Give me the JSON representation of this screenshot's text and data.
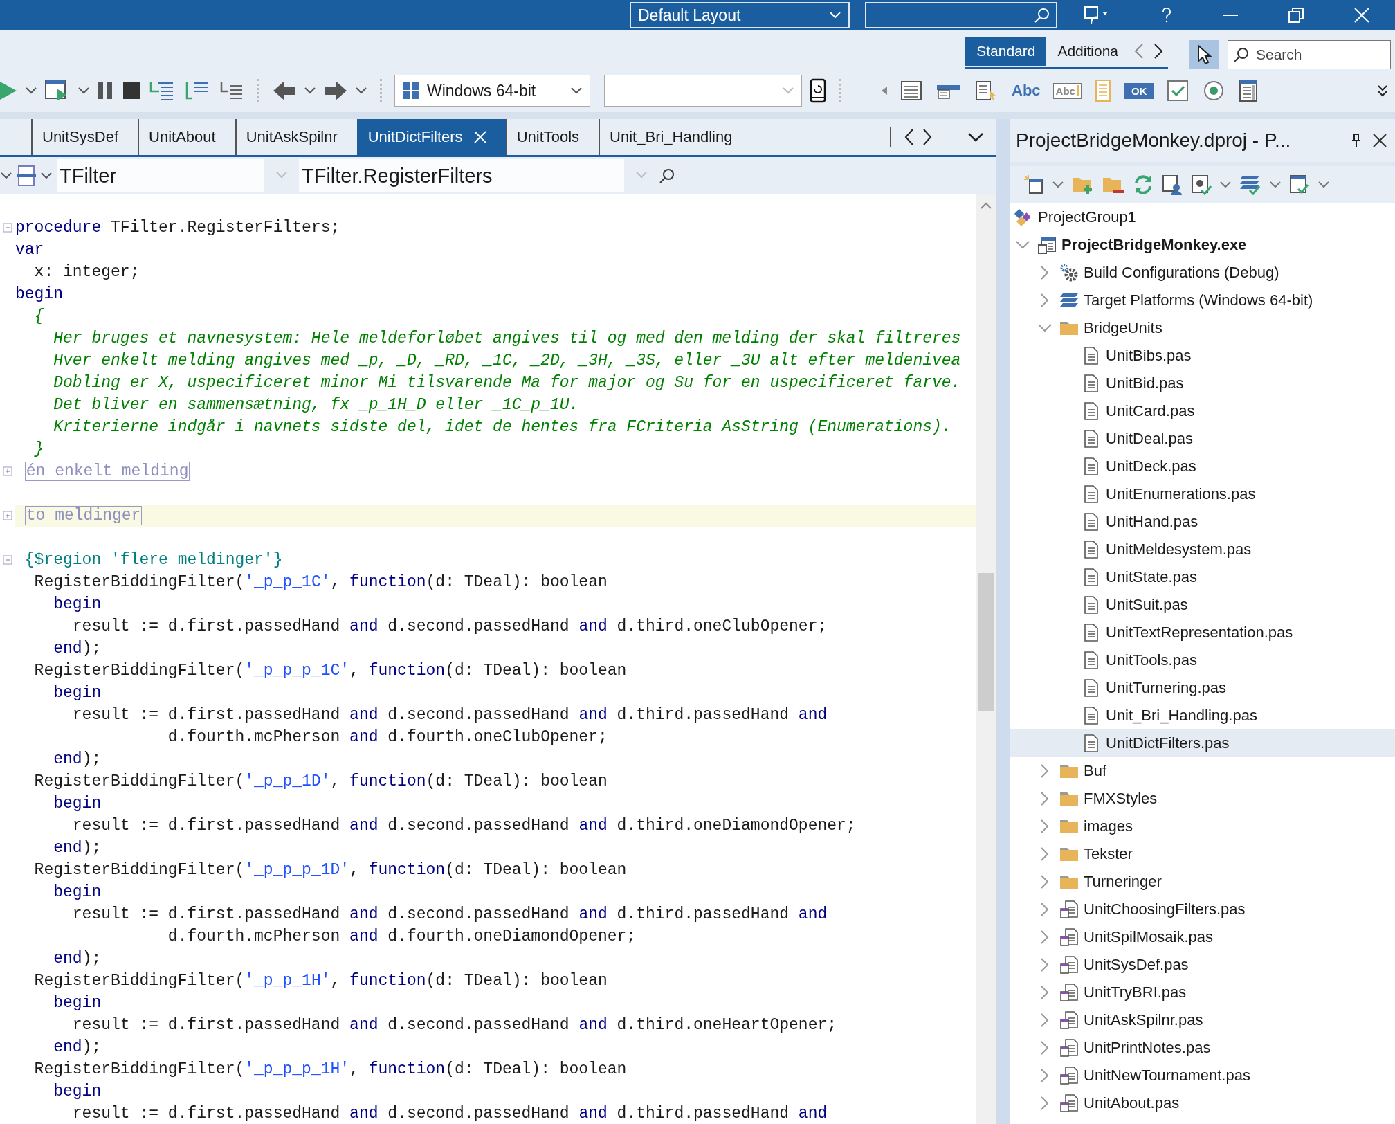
{
  "title_bar": {
    "layout": "Default Layout"
  },
  "palette": {
    "tabs": [
      {
        "label": "Standard",
        "selected": true
      },
      {
        "label": "Additiona",
        "selected": false
      }
    ],
    "search": {
      "placeholder": "Search"
    },
    "items": [
      {
        "kind": "frame"
      },
      {
        "kind": "menu"
      },
      {
        "kind": "popup"
      },
      {
        "kind": "label",
        "text": "Abc"
      },
      {
        "kind": "edit",
        "text": "Abc"
      },
      {
        "kind": "memo"
      },
      {
        "kind": "button",
        "text": "OK"
      },
      {
        "kind": "checkbox"
      },
      {
        "kind": "radio"
      },
      {
        "kind": "listbox"
      }
    ]
  },
  "toolbar": {
    "platform": "Windows 64-bit"
  },
  "editor": {
    "tabs": [
      {
        "label": "UnitSysDef",
        "selected": false
      },
      {
        "label": "UnitAbout",
        "selected": false
      },
      {
        "label": "UnitAskSpilnr",
        "selected": false
      },
      {
        "label": "UnitDictFilters",
        "selected": true
      },
      {
        "label": "UnitTools",
        "selected": false
      },
      {
        "label": "Unit_Bri_Handling",
        "selected": false
      }
    ],
    "nav": {
      "class": "TFilter",
      "method": "TFilter.RegisterFilters"
    },
    "lines": [
      {
        "current": false
      },
      {
        "current": false,
        "folded": false,
        "tokens": [
          {
            "kind": "keyword",
            "text": "procedure"
          },
          {
            "kind": "plain",
            "text": " TFilter.RegisterFilters;"
          }
        ]
      },
      {
        "current": false,
        "tokens": [
          {
            "kind": "keyword",
            "text": "var"
          }
        ]
      },
      {
        "current": false,
        "tokens": [
          {
            "kind": "plain",
            "text": "  x: integer;"
          }
        ]
      },
      {
        "current": false,
        "tokens": [
          {
            "kind": "keyword",
            "text": "begin"
          }
        ]
      },
      {
        "current": false,
        "tokens": [
          {
            "kind": "comment",
            "text": "  {"
          }
        ]
      },
      {
        "current": false,
        "tokens": [
          {
            "kind": "comment",
            "text": "    Her bruges et navnesystem: Hele meldeforløbet angives til og med den melding der skal filtreres"
          }
        ]
      },
      {
        "current": false,
        "tokens": [
          {
            "kind": "comment",
            "text": "    Hver enkelt melding angives med _p, _D, _RD, _1C, _2D, _3H, _3S, eller _3U alt efter meldenivea"
          }
        ]
      },
      {
        "current": false,
        "tokens": [
          {
            "kind": "comment",
            "text": "    Dobling er X, uspecificeret minor Mi tilsvarende Ma for major og Su for en uspecificeret farve."
          }
        ]
      },
      {
        "current": false,
        "tokens": [
          {
            "kind": "comment",
            "text": "    Det bliver en sammensætning, fx _p_1H_D eller _1C_p_1U."
          }
        ]
      },
      {
        "current": false,
        "tokens": [
          {
            "kind": "comment",
            "text": "    Kriterierne indgår i navnets sidste del, idet de hentes fra FCriteria AsString (Enumerations)."
          }
        ]
      },
      {
        "current": false,
        "tokens": [
          {
            "kind": "comment",
            "text": "  }"
          }
        ]
      },
      {
        "current": false,
        "folded": true,
        "region": "én enkelt melding"
      },
      {
        "current": false
      },
      {
        "current": true,
        "folded": true,
        "region": "to meldinger"
      },
      {
        "current": false
      },
      {
        "current": false,
        "folded": false,
        "tokens": [
          {
            "kind": "directive",
            "text": " {$region 'flere meldinger'}"
          }
        ]
      },
      {
        "current": false,
        "tokens": [
          {
            "kind": "plain",
            "text": "  RegisterBiddingFilter("
          },
          {
            "kind": "string",
            "text": "'_p_p_1C'"
          },
          {
            "kind": "plain",
            "text": ", "
          },
          {
            "kind": "keyword",
            "text": "function"
          },
          {
            "kind": "plain",
            "text": "(d: TDeal): boolean"
          }
        ]
      },
      {
        "current": false,
        "tokens": [
          {
            "kind": "keyword",
            "text": "    begin"
          }
        ]
      },
      {
        "current": false,
        "tokens": [
          {
            "kind": "plain",
            "text": "      result := d.first.passedHand "
          },
          {
            "kind": "keyword",
            "text": "and"
          },
          {
            "kind": "plain",
            "text": " d.second.passedHand "
          },
          {
            "kind": "keyword",
            "text": "and"
          },
          {
            "kind": "plain",
            "text": " d.third.oneClubOpener;"
          }
        ]
      },
      {
        "current": false,
        "tokens": [
          {
            "kind": "keyword",
            "text": "    end"
          },
          {
            "kind": "plain",
            "text": ");"
          }
        ]
      },
      {
        "current": false,
        "tokens": [
          {
            "kind": "plain",
            "text": "  RegisterBiddingFilter("
          },
          {
            "kind": "string",
            "text": "'_p_p_p_1C'"
          },
          {
            "kind": "plain",
            "text": ", "
          },
          {
            "kind": "keyword",
            "text": "function"
          },
          {
            "kind": "plain",
            "text": "(d: TDeal): boolean"
          }
        ]
      },
      {
        "current": false,
        "tokens": [
          {
            "kind": "keyword",
            "text": "    begin"
          }
        ]
      },
      {
        "current": false,
        "tokens": [
          {
            "kind": "plain",
            "text": "      result := d.first.passedHand "
          },
          {
            "kind": "keyword",
            "text": "and"
          },
          {
            "kind": "plain",
            "text": " d.second.passedHand "
          },
          {
            "kind": "keyword",
            "text": "and"
          },
          {
            "kind": "plain",
            "text": " d.third.passedHand "
          },
          {
            "kind": "keyword",
            "text": "and"
          }
        ]
      },
      {
        "current": false,
        "tokens": [
          {
            "kind": "plain",
            "text": "                d.fourth.mcPherson "
          },
          {
            "kind": "keyword",
            "text": "and"
          },
          {
            "kind": "plain",
            "text": " d.fourth.oneClubOpener;"
          }
        ]
      },
      {
        "current": false,
        "tokens": [
          {
            "kind": "keyword",
            "text": "    end"
          },
          {
            "kind": "plain",
            "text": ");"
          }
        ]
      },
      {
        "current": false,
        "tokens": [
          {
            "kind": "plain",
            "text": "  RegisterBiddingFilter("
          },
          {
            "kind": "string",
            "text": "'_p_p_1D'"
          },
          {
            "kind": "plain",
            "text": ", "
          },
          {
            "kind": "keyword",
            "text": "function"
          },
          {
            "kind": "plain",
            "text": "(d: TDeal): boolean"
          }
        ]
      },
      {
        "current": false,
        "tokens": [
          {
            "kind": "keyword",
            "text": "    begin"
          }
        ]
      },
      {
        "current": false,
        "tokens": [
          {
            "kind": "plain",
            "text": "      result := d.first.passedHand "
          },
          {
            "kind": "keyword",
            "text": "and"
          },
          {
            "kind": "plain",
            "text": " d.second.passedHand "
          },
          {
            "kind": "keyword",
            "text": "and"
          },
          {
            "kind": "plain",
            "text": " d.third.oneDiamondOpener;"
          }
        ]
      },
      {
        "current": false,
        "tokens": [
          {
            "kind": "keyword",
            "text": "    end"
          },
          {
            "kind": "plain",
            "text": ");"
          }
        ]
      },
      {
        "current": false,
        "tokens": [
          {
            "kind": "plain",
            "text": "  RegisterBiddingFilter("
          },
          {
            "kind": "string",
            "text": "'_p_p_p_1D'"
          },
          {
            "kind": "plain",
            "text": ", "
          },
          {
            "kind": "keyword",
            "text": "function"
          },
          {
            "kind": "plain",
            "text": "(d: TDeal): boolean"
          }
        ]
      },
      {
        "current": false,
        "tokens": [
          {
            "kind": "keyword",
            "text": "    begin"
          }
        ]
      },
      {
        "current": false,
        "tokens": [
          {
            "kind": "plain",
            "text": "      result := d.first.passedHand "
          },
          {
            "kind": "keyword",
            "text": "and"
          },
          {
            "kind": "plain",
            "text": " d.second.passedHand "
          },
          {
            "kind": "keyword",
            "text": "and"
          },
          {
            "kind": "plain",
            "text": " d.third.passedHand "
          },
          {
            "kind": "keyword",
            "text": "and"
          }
        ]
      },
      {
        "current": false,
        "tokens": [
          {
            "kind": "plain",
            "text": "                d.fourth.mcPherson "
          },
          {
            "kind": "keyword",
            "text": "and"
          },
          {
            "kind": "plain",
            "text": " d.fourth.oneDiamondOpener;"
          }
        ]
      },
      {
        "current": false,
        "tokens": [
          {
            "kind": "keyword",
            "text": "    end"
          },
          {
            "kind": "plain",
            "text": ");"
          }
        ]
      },
      {
        "current": false,
        "tokens": [
          {
            "kind": "plain",
            "text": "  RegisterBiddingFilter("
          },
          {
            "kind": "string",
            "text": "'_p_p_1H'"
          },
          {
            "kind": "plain",
            "text": ", "
          },
          {
            "kind": "keyword",
            "text": "function"
          },
          {
            "kind": "plain",
            "text": "(d: TDeal): boolean"
          }
        ]
      },
      {
        "current": false,
        "tokens": [
          {
            "kind": "keyword",
            "text": "    begin"
          }
        ]
      },
      {
        "current": false,
        "tokens": [
          {
            "kind": "plain",
            "text": "      result := d.first.passedHand "
          },
          {
            "kind": "keyword",
            "text": "and"
          },
          {
            "kind": "plain",
            "text": " d.second.passedHand "
          },
          {
            "kind": "keyword",
            "text": "and"
          },
          {
            "kind": "plain",
            "text": " d.third.oneHeartOpener;"
          }
        ]
      },
      {
        "current": false,
        "tokens": [
          {
            "kind": "keyword",
            "text": "    end"
          },
          {
            "kind": "plain",
            "text": ");"
          }
        ]
      },
      {
        "current": false,
        "tokens": [
          {
            "kind": "plain",
            "text": "  RegisterBiddingFilter("
          },
          {
            "kind": "string",
            "text": "'_p_p_p_1H'"
          },
          {
            "kind": "plain",
            "text": ", "
          },
          {
            "kind": "keyword",
            "text": "function"
          },
          {
            "kind": "plain",
            "text": "(d: TDeal): boolean"
          }
        ]
      },
      {
        "current": false,
        "tokens": [
          {
            "kind": "keyword",
            "text": "    begin"
          }
        ]
      },
      {
        "current": false,
        "tokens": [
          {
            "kind": "plain",
            "text": "      result := d.first.passedHand "
          },
          {
            "kind": "keyword",
            "text": "and"
          },
          {
            "kind": "plain",
            "text": " d.second.passedHand "
          },
          {
            "kind": "keyword",
            "text": "and"
          },
          {
            "kind": "plain",
            "text": " d.third.passedHand "
          },
          {
            "kind": "keyword",
            "text": "and"
          }
        ]
      }
    ]
  },
  "project_manager": {
    "title": "ProjectBridgeMonkey.dproj - P...",
    "tree": [
      {
        "label": "ProjectGroup1",
        "kind": "group",
        "selected": false,
        "children": [
          {
            "label": "ProjectBridgeMonkey.exe",
            "kind": "project",
            "selected": false,
            "expanded": true,
            "children": [
              {
                "label": "Build Configurations (Debug)",
                "kind": "config",
                "selected": false,
                "expanded": false
              },
              {
                "label": "Target Platforms (Windows 64-bit)",
                "kind": "platform",
                "selected": false,
                "expanded": false
              },
              {
                "label": "BridgeUnits",
                "kind": "folder",
                "selected": false,
                "expanded": true,
                "children": [
                  {
                    "label": "UnitBibs.pas",
                    "kind": "file",
                    "selected": false
                  },
                  {
                    "label": "UnitBid.pas",
                    "kind": "file",
                    "selected": false
                  },
                  {
                    "label": "UnitCard.pas",
                    "kind": "file",
                    "selected": false
                  },
                  {
                    "label": "UnitDeal.pas",
                    "kind": "file",
                    "selected": false
                  },
                  {
                    "label": "UnitDeck.pas",
                    "kind": "file",
                    "selected": false
                  },
                  {
                    "label": "UnitEnumerations.pas",
                    "kind": "file",
                    "selected": false
                  },
                  {
                    "label": "UnitHand.pas",
                    "kind": "file",
                    "selected": false
                  },
                  {
                    "label": "UnitMeldesystem.pas",
                    "kind": "file",
                    "selected": false
                  },
                  {
                    "label": "UnitState.pas",
                    "kind": "file",
                    "selected": false
                  },
                  {
                    "label": "UnitSuit.pas",
                    "kind": "file",
                    "selected": false
                  },
                  {
                    "label": "UnitTextRepresentation.pas",
                    "kind": "file",
                    "selected": false
                  },
                  {
                    "label": "UnitTools.pas",
                    "kind": "file",
                    "selected": false
                  },
                  {
                    "label": "UnitTurnering.pas",
                    "kind": "file",
                    "selected": false
                  },
                  {
                    "label": "Unit_Bri_Handling.pas",
                    "kind": "file",
                    "selected": false
                  },
                  {
                    "label": "UnitDictFilters.pas",
                    "kind": "file",
                    "selected": true
                  }
                ]
              },
              {
                "label": "Buf",
                "kind": "folder",
                "selected": false,
                "expanded": false
              },
              {
                "label": "FMXStyles",
                "kind": "folder",
                "selected": false,
                "expanded": false
              },
              {
                "label": "images",
                "kind": "folder",
                "selected": false,
                "expanded": false
              },
              {
                "label": "Tekster",
                "kind": "folder",
                "selected": false,
                "expanded": false
              },
              {
                "label": "Turneringer",
                "kind": "folder",
                "selected": false,
                "expanded": false
              },
              {
                "label": "UnitChoosingFilters.pas",
                "kind": "form",
                "selected": false,
                "expanded": false
              },
              {
                "label": "UnitSpilMosaik.pas",
                "kind": "form",
                "selected": false,
                "expanded": false
              },
              {
                "label": "UnitSysDef.pas",
                "kind": "form",
                "selected": false,
                "expanded": false
              },
              {
                "label": "UnitTryBRI.pas",
                "kind": "form",
                "selected": false,
                "expanded": false
              },
              {
                "label": "UnitAskSpilnr.pas",
                "kind": "form",
                "selected": false,
                "expanded": false
              },
              {
                "label": "UnitPrintNotes.pas",
                "kind": "form",
                "selected": false,
                "expanded": false
              },
              {
                "label": "UnitNewTournament.pas",
                "kind": "form",
                "selected": false,
                "expanded": false
              },
              {
                "label": "UnitAbout.pas",
                "kind": "form",
                "selected": false,
                "expanded": false
              }
            ]
          }
        ]
      }
    ]
  }
}
